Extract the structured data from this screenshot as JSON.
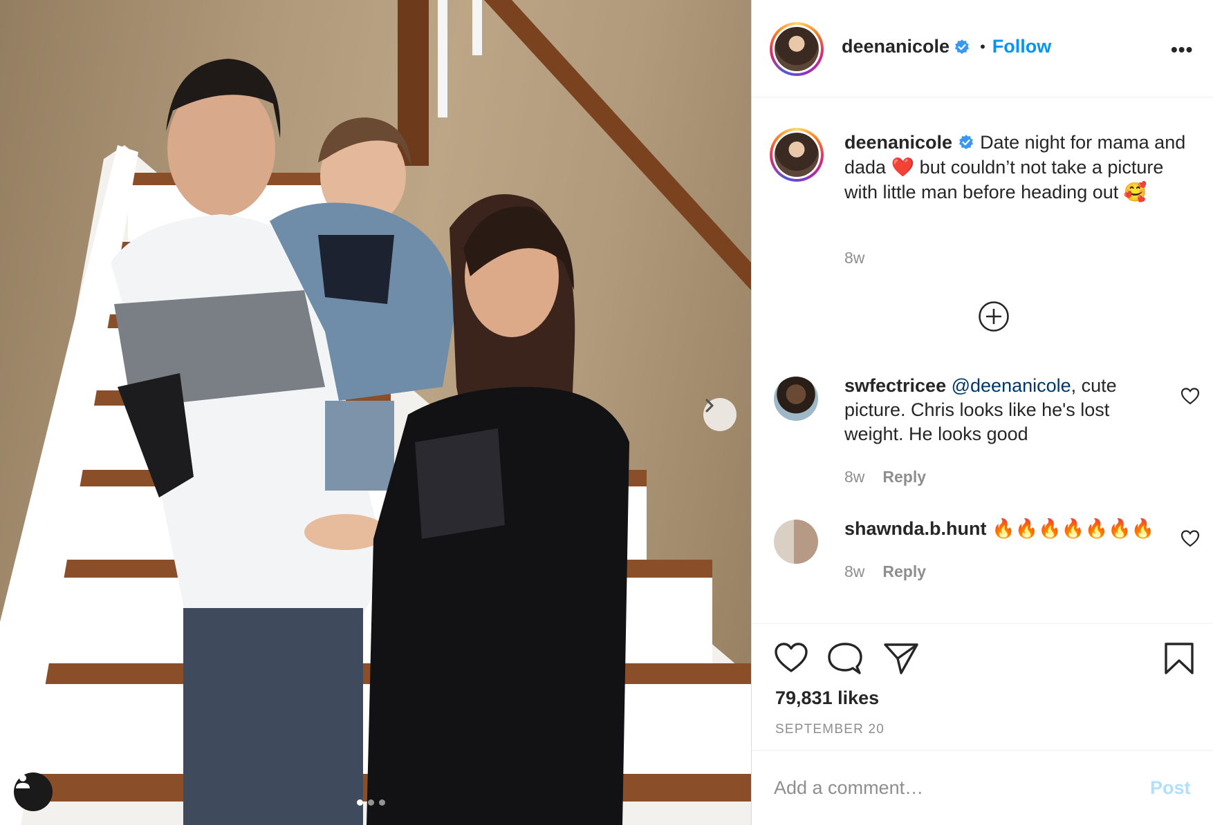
{
  "colors": {
    "accent": "#0095f6",
    "text_primary": "#262626",
    "text_secondary": "#8e8e8e",
    "post_disabled": "#b2dffc",
    "mention": "#00376b"
  },
  "post": {
    "author": "deenanicole",
    "follow_label": "Follow",
    "more_icon": "more-horizontal-icon",
    "caption_text": "Date night for mama and dada ❤️ but couldn’t not take a picture with little man before heading out 🥰",
    "caption_time": "8w",
    "load_more_icon": "plus-circle-icon",
    "comments": [
      {
        "user": "swfectricee",
        "mention": "@deenanicole",
        "text": ", cute picture. Chris looks like he's lost weight. He looks good",
        "time": "8w",
        "reply_label": "Reply"
      },
      {
        "user": "shawnda.b.hunt",
        "mention": "",
        "text": "🔥🔥🔥🔥🔥🔥🔥",
        "time": "8w",
        "reply_label": "Reply"
      }
    ],
    "likes": "79,831 likes",
    "date": "SEPTEMBER 20",
    "add_comment_placeholder": "Add a comment…",
    "post_label": "Post"
  },
  "carousel": {
    "slide_count": 3,
    "active_slide": 1
  }
}
